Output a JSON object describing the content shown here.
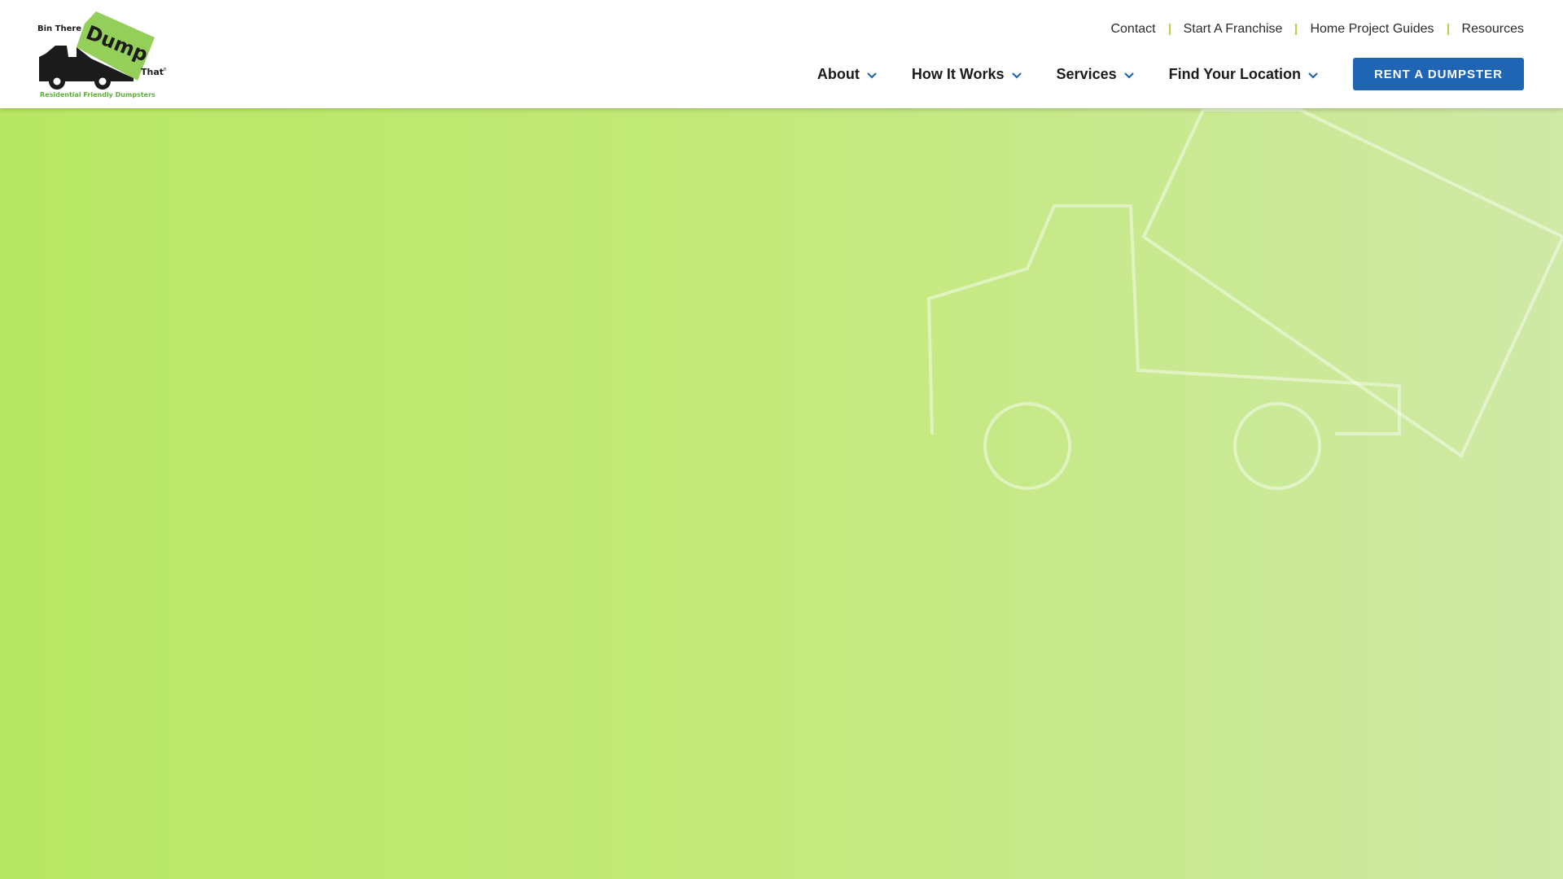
{
  "brand": {
    "logo_line1": "Bin There",
    "logo_word": "Dump",
    "logo_word2": "That",
    "trademark": "®",
    "tagline": "Residential Friendly Dumpsters"
  },
  "utility_nav": {
    "items": [
      {
        "label": "Contact"
      },
      {
        "label": "Start A Franchise"
      },
      {
        "label": "Home Project Guides"
      },
      {
        "label": "Resources"
      }
    ]
  },
  "main_nav": {
    "items": [
      {
        "label": "About",
        "icon": "chevron-down-icon"
      },
      {
        "label": "How It Works",
        "icon": "chevron-down-icon"
      },
      {
        "label": "Services",
        "icon": "chevron-down-icon"
      },
      {
        "label": "Find Your Location",
        "icon": "chevron-down-icon"
      }
    ],
    "cta_label": "RENT A DUMPSTER"
  },
  "colors": {
    "accent_blue": "#2065b3",
    "separator_green": "#b9d24a",
    "hero_green_start": "#b8e764",
    "hero_green_end": "#cfe9a6",
    "logo_green": "#94cf59",
    "logo_tagline_green": "#5fae3a"
  }
}
